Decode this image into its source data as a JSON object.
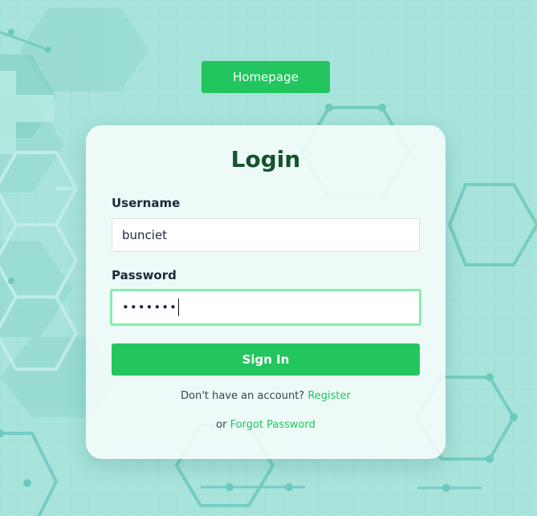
{
  "nav": {
    "homepage_label": "Homepage"
  },
  "login": {
    "title": "Login",
    "username_label": "Username",
    "username_value": "bunciet",
    "password_label": "Password",
    "password_masked": "•••••••",
    "signin_label": "Sign In",
    "register_prompt": "Don't have an account?",
    "register_link": "Register",
    "or_text": "or",
    "forgot_link": "Forgot Password"
  },
  "colors": {
    "background": "#a6e3db",
    "accent": "#22c55e",
    "title": "#14532d",
    "focus_ring": "#86efac"
  },
  "icons": {
    "background_pattern": "hexagon-molecule-pattern"
  }
}
